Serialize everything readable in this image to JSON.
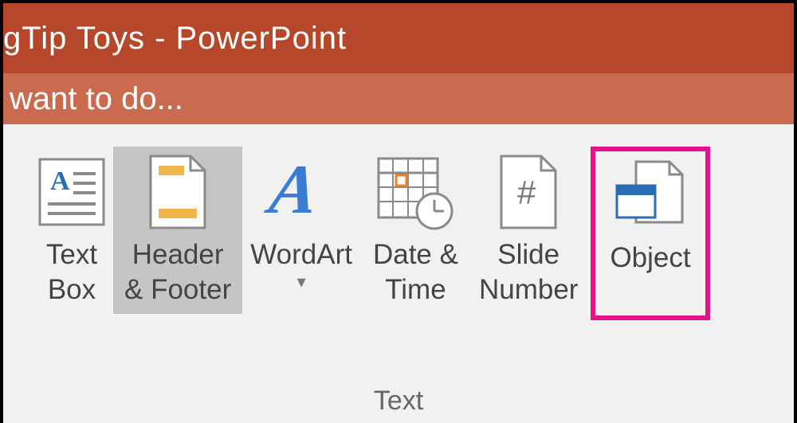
{
  "titlebar": {
    "title": "gTip Toys - PowerPoint"
  },
  "tellme": {
    "placeholder": "want to do..."
  },
  "ribbon": {
    "group_label": "Text",
    "buttons": {
      "textbox": {
        "line1": "Text",
        "line2": "Box"
      },
      "headerfooter": {
        "line1": "Header",
        "line2": "& Footer"
      },
      "wordart": {
        "line1": "WordArt"
      },
      "datetime": {
        "line1": "Date &",
        "line2": "Time"
      },
      "slidenumber": {
        "line1": "Slide",
        "line2": "Number"
      },
      "object": {
        "line1": "Object"
      }
    }
  }
}
